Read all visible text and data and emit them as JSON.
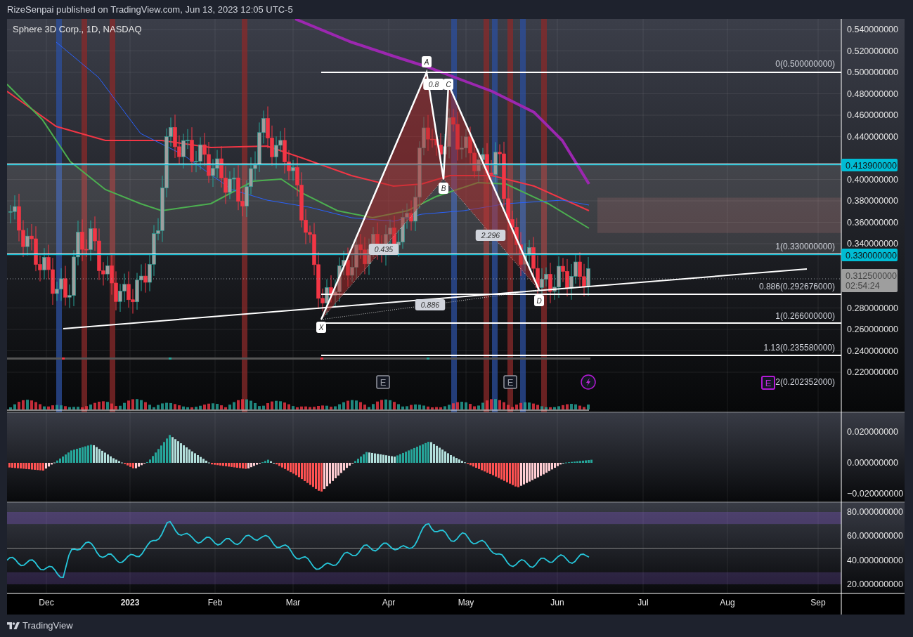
{
  "header": {
    "text": "RizeSenpai published on TradingView.com, Jun 13, 2023 12:05 UTC-5"
  },
  "chart": {
    "title": "Sphere 3D Corp., 1D, NASDAQ",
    "price_axis": [
      "0.540000000",
      "0.520000000",
      "0.500000000",
      "0.480000000",
      "0.460000000",
      "0.440000000",
      "0.400000000",
      "0.380000000",
      "0.360000000",
      "0.340000000",
      "0.280000000",
      "0.260000000",
      "0.240000000",
      "0.220000000"
    ],
    "price_badges": [
      {
        "kind": "level",
        "text": "0.413900000"
      },
      {
        "kind": "level",
        "text": "0.330000000"
      },
      {
        "kind": "last",
        "text": "0.312500000",
        "countdown": "02:54:24"
      }
    ],
    "fib_labels": [
      "0(0.500000000)",
      "1(0.330000000)",
      "0.886(0.292676000)",
      "1(0.266000000)",
      "1.13(0.235580000)",
      "2(0.202352000)"
    ],
    "pattern_points": [
      "X",
      "A",
      "B",
      "C",
      "D"
    ],
    "pattern_ratios": [
      "0.8",
      "0.435",
      "2.296",
      "0.886"
    ],
    "event_markers": [
      {
        "kind": "earnings",
        "text": "E"
      },
      {
        "kind": "earnings",
        "text": "E"
      },
      {
        "kind": "split"
      },
      {
        "kind": "upcoming",
        "text": "E"
      }
    ],
    "macd_axis": [
      "0.020000000",
      "0.000000000",
      "−0.020000000"
    ],
    "rsi_axis": [
      "80.000000000",
      "60.000000000",
      "40.000000000",
      "20.000000000"
    ],
    "time_axis": [
      {
        "text": "Dec",
        "bold": false
      },
      {
        "text": "2023",
        "bold": true
      },
      {
        "text": "Feb",
        "bold": false
      },
      {
        "text": "Mar",
        "bold": false
      },
      {
        "text": "Apr",
        "bold": false
      },
      {
        "text": "May",
        "bold": false
      },
      {
        "text": "Jun",
        "bold": false
      },
      {
        "text": "Jul",
        "bold": false
      },
      {
        "text": "Aug",
        "bold": false
      },
      {
        "text": "Sep",
        "bold": false
      }
    ]
  },
  "footer": {
    "brand": "TradingView"
  }
}
